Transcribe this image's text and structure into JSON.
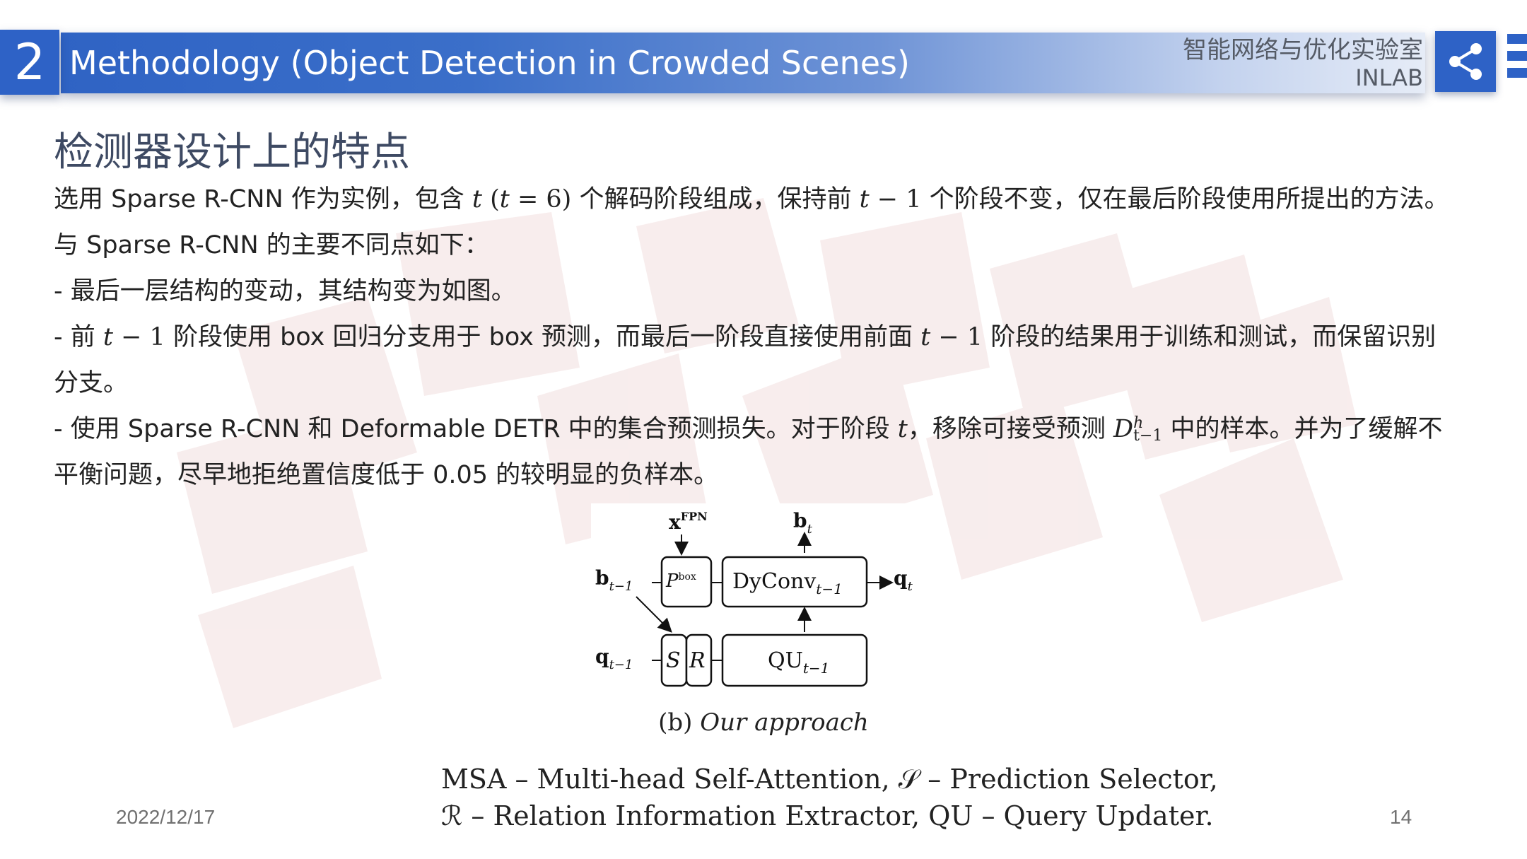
{
  "header": {
    "section_number": "2",
    "title": "Methodology (Object Detection in Crowded Scenes)",
    "lab_name": "智能网络与优化实验室",
    "lab_abbr": "INLAB",
    "share_icon": "share-icon"
  },
  "slide": {
    "subtitle": "检测器设计上的特点",
    "lines": [
      {
        "p1": "选用 Sparse R-CNN 作为实例，包含 ",
        "m1": "t",
        "m2": " (",
        "m3": "t",
        "m4": " = 6)",
        "p2": " 个解码阶段组成，保持前 ",
        "m5": "t",
        "m6": " − 1",
        "p3": " 个阶段不变，仅在最后阶段使用所提出的方法。"
      },
      {
        "text": "与 Sparse R-CNN 的主要不同点如下："
      },
      {
        "text": "- 最后一层结构的变动，其结构变为如图。"
      },
      {
        "p1": "- 前 ",
        "m1": "t",
        "m2": " − 1",
        "p2": " 阶段使用 box 回归分支用于 box 预测，而最后一阶段直接使用前面 ",
        "m3": "t",
        "m4": " − 1",
        "p3": " 阶段的结果用于训练和测试，而保留识别"
      },
      {
        "text": "分支。"
      },
      {
        "p1": "- 使用 Sparse R-CNN 和 Deformable DETR 中的集合预测损失。对于阶段 ",
        "m1": "t",
        "p2": "，移除可接受预测 ",
        "m2": "D",
        "sup": "h",
        "sub": "t−1",
        "p3": " 中的样本。并为了缓解不"
      },
      {
        "text": "平衡问题，尽早地拒绝置信度低于 0.05 的较明显的负样本。"
      }
    ]
  },
  "figure": {
    "x_fpn": "x",
    "x_fpn_sup": "FPN",
    "b_t": "b",
    "b_t_sub": "t",
    "b_prev": "b",
    "b_prev_sub": "t−1",
    "q_prev": "q",
    "q_prev_sub": "t−1",
    "q_t": "q",
    "q_t_sub": "t",
    "p_box": "P",
    "p_box_sup": "box",
    "dyconv": "DyConv",
    "dyconv_sub": "t−1",
    "s_block": "S",
    "r_block": "R",
    "qu": "QU",
    "qu_sub": "t−1",
    "caption_prefix": "(b) ",
    "caption_italic": "Our approach"
  },
  "legend": {
    "line1": "MSA – Multi-head Self-Attention, 𝒮 – Prediction Selector,",
    "line2": "ℛ – Relation Information Extractor, QU – Query Updater."
  },
  "footer": {
    "date": "2022/12/17",
    "page": "14"
  },
  "colors": {
    "accent": "#2e62c6",
    "watermark": "#f7e9e9"
  }
}
